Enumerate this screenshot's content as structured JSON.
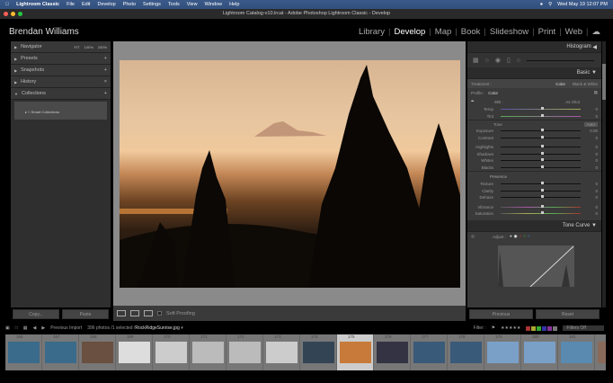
{
  "menubar": {
    "apple": "",
    "app": "Lightroom Classic",
    "items": [
      "File",
      "Edit",
      "Develop",
      "Photo",
      "Settings",
      "Tools",
      "View",
      "Window",
      "Help"
    ],
    "datetime": "Wed May 19  12:07 PM"
  },
  "window": {
    "title": "Lightroom Catalog-v10.lrcat - Adobe Photoshop Lightroom Classic - Develop"
  },
  "identity": {
    "name": "Brendan Williams",
    "modules": [
      "Library",
      "Develop",
      "Map",
      "Book",
      "Slideshow",
      "Print",
      "Web"
    ],
    "active": "Develop"
  },
  "left_panel": {
    "navigator": {
      "label": "Navigator",
      "zoom": [
        "FIT",
        "100%",
        "200%"
      ]
    },
    "panels": [
      "Presets",
      "Snapshots",
      "History",
      "Collections"
    ],
    "smart_collections": "Smart Collections",
    "copy": "Copy...",
    "paste": "Paste"
  },
  "toolbar": {
    "soft_proofing": "Soft Proofing"
  },
  "right_panel": {
    "histogram": "Histogram",
    "basic": "Basic",
    "treatment": "Treatment :",
    "color": "Color",
    "bw": "Black & White",
    "profile": "Profile :",
    "profile_value": "Color",
    "wb": "WB :",
    "wb_value": "As Shot",
    "wb_sliders": [
      {
        "label": "Temp",
        "value": "0"
      },
      {
        "label": "Tint",
        "value": "0"
      }
    ],
    "tone": "Tone",
    "auto": "Auto",
    "tone_sliders": [
      {
        "label": "Exposure",
        "value": "0.00"
      },
      {
        "label": "Contrast",
        "value": "0"
      }
    ],
    "tone_sliders2": [
      {
        "label": "Highlights",
        "value": "0"
      },
      {
        "label": "Shadows",
        "value": "0"
      },
      {
        "label": "Whites",
        "value": "0"
      },
      {
        "label": "Blacks",
        "value": "0"
      }
    ],
    "presence": "Presence",
    "presence_sliders": [
      {
        "label": "Texture",
        "value": "0"
      },
      {
        "label": "Clarity",
        "value": "0"
      },
      {
        "label": "Dehaze",
        "value": "0"
      }
    ],
    "presence_sliders2": [
      {
        "label": "Vibrance",
        "value": "0"
      },
      {
        "label": "Saturation",
        "value": "0"
      }
    ],
    "tone_curve": "Tone Curve",
    "adjust": "Adjust :",
    "previous": "Previous",
    "reset": "Reset"
  },
  "filmstrip": {
    "source": "Previous Import",
    "count": "396 photos /1 selected /",
    "file": "RockRidgeSunrise.jpg",
    "filter": "Filter :",
    "filters_off": "Filters Off",
    "numbers": [
      "166",
      "167",
      "168",
      "169",
      "170",
      "171",
      "172",
      "173",
      "174",
      "175",
      "176",
      "177",
      "178",
      "179",
      "180",
      "181",
      "182"
    ],
    "selected": "175"
  }
}
